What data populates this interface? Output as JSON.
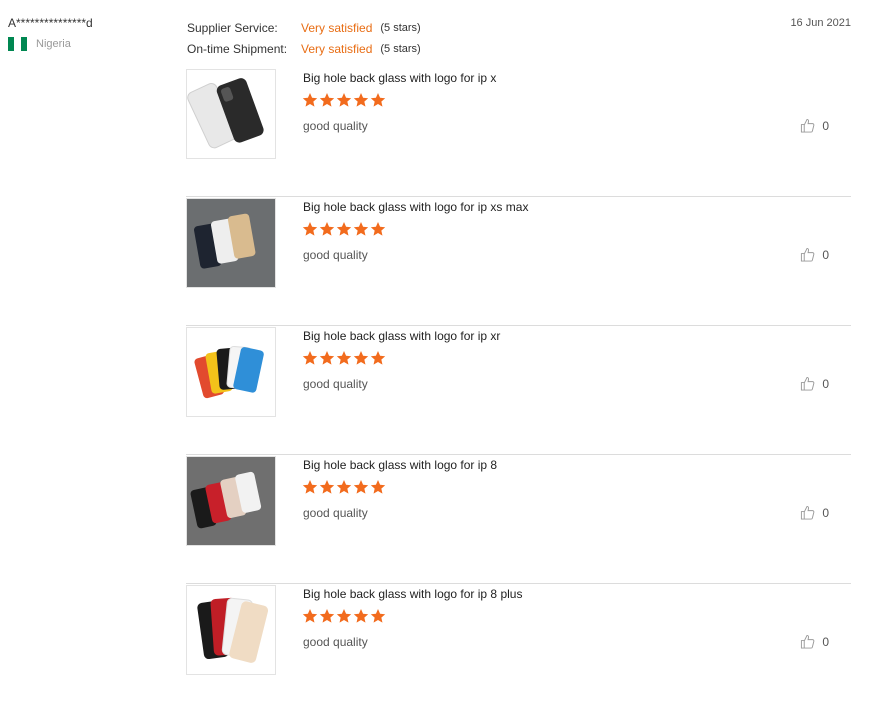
{
  "review": {
    "buyer_name": "A***************d",
    "country": "Nigeria",
    "date": "16 Jun 2021",
    "ratings": [
      {
        "label": "Supplier Service:",
        "value": "Very satisfied",
        "stars_text": "(5 stars)"
      },
      {
        "label": "On-time Shipment:",
        "value": "Very satisfied",
        "stars_text": "(5 stars)"
      }
    ]
  },
  "colors": {
    "accent": "#e86d14",
    "star": "#f26b1d",
    "flag_green": "#008751",
    "flag_white": "#ffffff"
  },
  "items": [
    {
      "title": "Big hole back glass with logo for ip x",
      "rating": 5,
      "comment": "good quality",
      "likes": "0"
    },
    {
      "title": "Big hole back glass with logo for ip xs max",
      "rating": 5,
      "comment": "good quality",
      "likes": "0"
    },
    {
      "title": "Big hole back glass with logo for ip xr",
      "rating": 5,
      "comment": "good quality",
      "likes": "0"
    },
    {
      "title": "Big hole back glass with logo for ip 8",
      "rating": 5,
      "comment": "good quality",
      "likes": "0"
    },
    {
      "title": "Big hole back glass with logo for ip 8 plus",
      "rating": 5,
      "comment": "good quality",
      "likes": "0"
    }
  ]
}
